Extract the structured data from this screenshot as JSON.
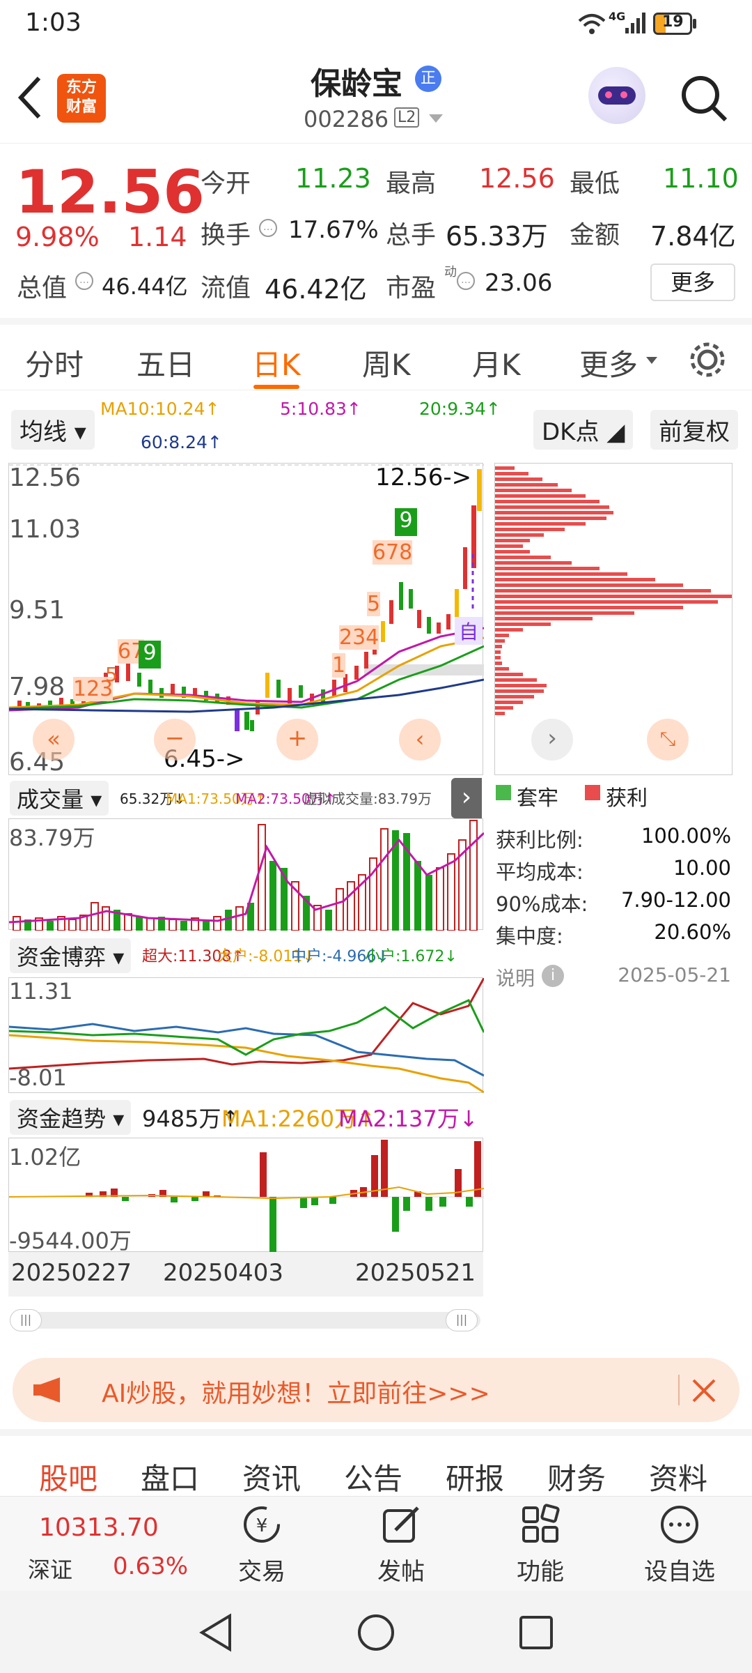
{
  "status": {
    "time": "1:03",
    "battery": "19",
    "network": "4G"
  },
  "header": {
    "logo_line1": "东方",
    "logo_line2": "财富",
    "name": "保龄宝",
    "badge": "正",
    "code": "002286",
    "level": "L2"
  },
  "quote": {
    "price": "12.56",
    "pct": "9.98%",
    "chg": "1.14",
    "open_label": "今开",
    "open": "11.23",
    "high_label": "最高",
    "high": "12.56",
    "low_label": "最低",
    "low": "11.10",
    "turnover_label": "换手",
    "turnover": "17.67%",
    "volume_label": "总手",
    "volume": "65.33万",
    "amount_label": "金额",
    "amount": "7.84亿",
    "mcap_label": "总值",
    "mcap": "46.44亿",
    "float_label": "流值",
    "float": "46.42亿",
    "pe_label": "市盈",
    "pe_sup": "动",
    "pe": "23.06",
    "more": "更多"
  },
  "tabs": [
    {
      "label": "分时"
    },
    {
      "label": "五日"
    },
    {
      "label": "日K"
    },
    {
      "label": "周K"
    },
    {
      "label": "月K"
    },
    {
      "label": "更多"
    }
  ],
  "kline": {
    "ma_button": "均线",
    "ma10": "MA10:10.24↑",
    "ma5": "5:10.83↑",
    "ma20": "20:9.34↑",
    "ma60": "60:8.24↑",
    "dk_button": "DK点",
    "adjust_button": "前复权",
    "y_labels": [
      "12.56",
      "11.03",
      "9.51",
      "7.98",
      "6.45"
    ],
    "high_marker": "12.56->",
    "low_marker": "6.45->",
    "td_left": "123",
    "td_num5a": "5",
    "td_num6": "67",
    "td_nine_a": "9",
    "td_right_a": "234",
    "td_one": "1",
    "td_num5b": "5",
    "td_num6b": "678",
    "td_nine_b": "9",
    "auto_tag": "自"
  },
  "chip": {
    "legend_hold": "套牢",
    "legend_profit": "获利",
    "rows": [
      {
        "label": "获利比例:",
        "value": "100.00%"
      },
      {
        "label": "平均成本:",
        "value": "10.00"
      },
      {
        "label": "90%成本:",
        "value": "7.90-12.00"
      },
      {
        "label": "集中度:",
        "value": "20.60%"
      }
    ],
    "explain": "说明",
    "date": "2025-05-21"
  },
  "volume": {
    "button": "成交量",
    "vol": "65.32万↓",
    "ma1": "MA1:73.50万↑",
    "ma2": "MA2:73.50万↑",
    "virtual": "虚拟成交量:83.79万",
    "y_top": "83.79万"
  },
  "fund_game": {
    "button": "资金博弈",
    "big": "超大:11.308↑",
    "large": "大户:-8.011↓",
    "mid": "中户:-4.966↓",
    "small": "小户:1.672↓",
    "y_top": "11.31",
    "y_bottom": "-8.01"
  },
  "fund_trend": {
    "button": "资金趋势",
    "value": "9485万↑",
    "ma1": "MA1:2260万↑",
    "ma2": "MA2:137万↓",
    "y_top": "1.02亿",
    "y_bottom": "-9544.00万"
  },
  "dates": [
    "20250227",
    "20250403",
    "20250521"
  ],
  "banner": {
    "text": "AI炒股，就用妙想！立即前往>>>"
  },
  "bottom_tabs": [
    {
      "label": "股吧"
    },
    {
      "label": "盘口"
    },
    {
      "label": "资讯"
    },
    {
      "label": "公告"
    },
    {
      "label": "研报"
    },
    {
      "label": "财务"
    },
    {
      "label": "资料"
    }
  ],
  "toolbar": {
    "index_value": "10313.70",
    "index_name": "深证",
    "index_pct": "0.63%",
    "trade": "交易",
    "post": "发帖",
    "func": "功能",
    "watch": "设自选"
  },
  "colors": {
    "up": "#e03131",
    "down": "#1a9e1a",
    "accent": "#ff6a00"
  }
}
